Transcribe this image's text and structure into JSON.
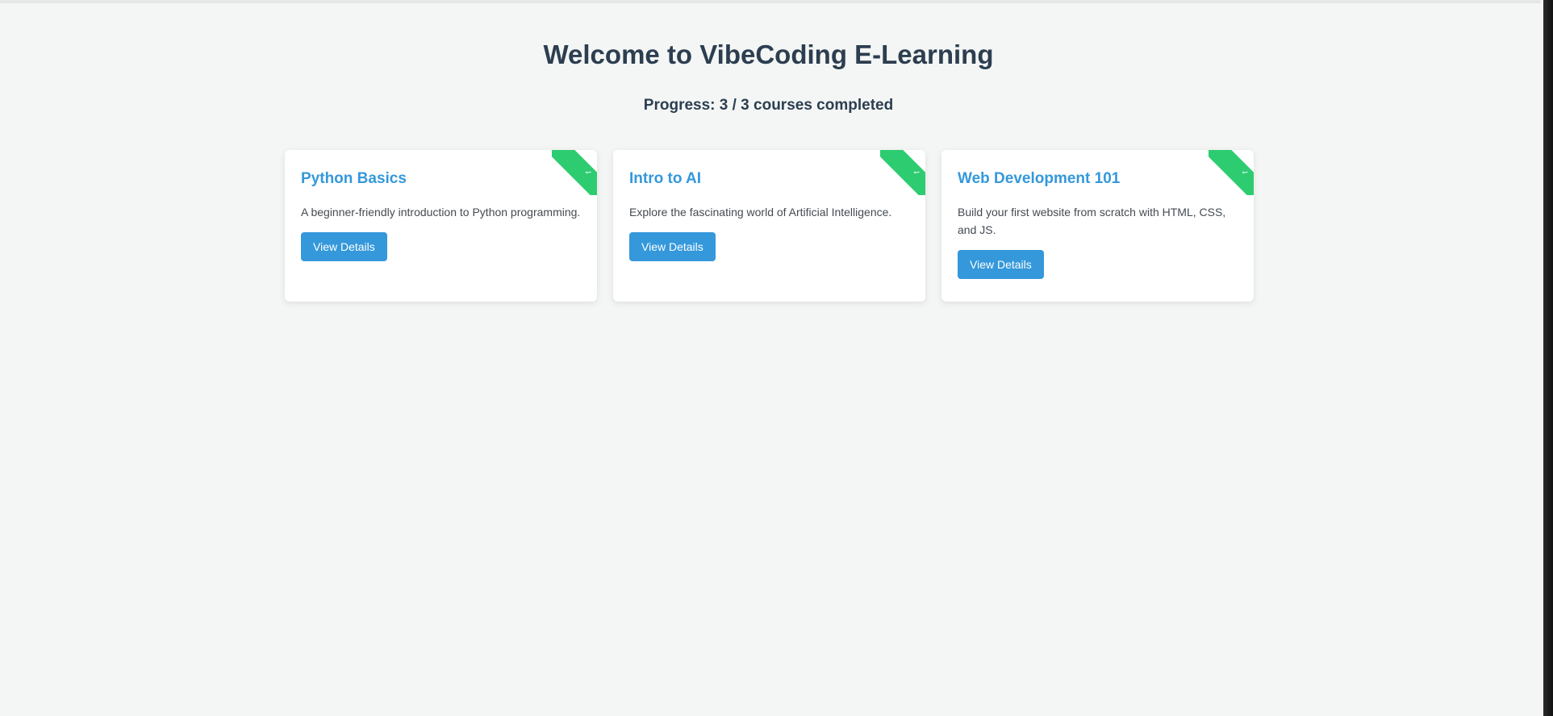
{
  "header": {
    "title": "Welcome to VibeCoding E-Learning",
    "progress": "Progress: 3 / 3 courses completed"
  },
  "courses": [
    {
      "title": "Python Basics",
      "description": "A beginner-friendly introduction to Python programming.",
      "button_label": "View Details",
      "completed_icon": "checkmark-ribbon"
    },
    {
      "title": "Intro to AI",
      "description": "Explore the fascinating world of Artificial Intelligence.",
      "button_label": "View Details",
      "completed_icon": "checkmark-ribbon"
    },
    {
      "title": "Web Development 101",
      "description": "Build your first website from scratch with HTML, CSS, and JS.",
      "button_label": "View Details",
      "completed_icon": "checkmark-ribbon"
    }
  ],
  "colors": {
    "accent": "#3498db",
    "completed": "#2ecc71",
    "heading": "#2c3e50",
    "background": "#f4f6f5"
  }
}
